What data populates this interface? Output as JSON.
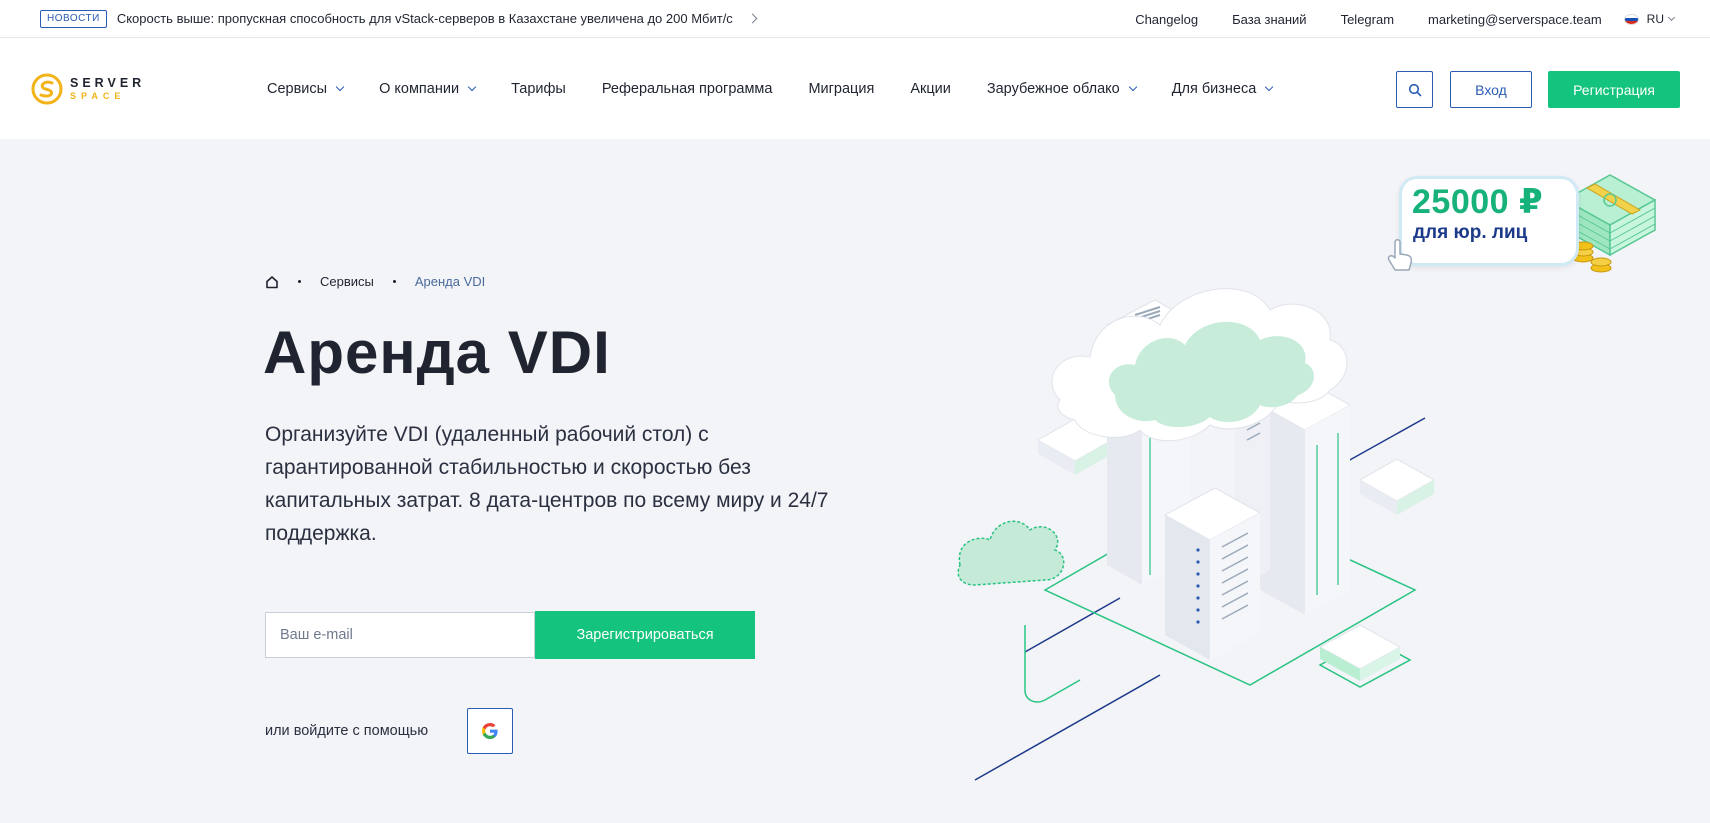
{
  "topbar": {
    "news_badge": "НОВОСТИ",
    "news_text": "Скорость выше: пропускная способность для vStack-серверов в Казахстане увеличена до 200 Мбит/с",
    "links": [
      "Changelog",
      "База знаний",
      "Telegram",
      "marketing@serverspace.team"
    ],
    "lang": "RU"
  },
  "logo": {
    "line1": "SERVER",
    "line2": "SPACE"
  },
  "nav": {
    "items": [
      {
        "label": "Сервисы",
        "dropdown": true
      },
      {
        "label": "О компании",
        "dropdown": true
      },
      {
        "label": "Тарифы",
        "dropdown": false
      },
      {
        "label": "Реферальная программа",
        "dropdown": false
      },
      {
        "label": "Миграция",
        "dropdown": false
      },
      {
        "label": "Акции",
        "dropdown": false
      },
      {
        "label": "Зарубежное облако",
        "dropdown": true
      },
      {
        "label": "Для бизнеса",
        "dropdown": true
      }
    ],
    "login": "Вход",
    "register": "Регистрация"
  },
  "breadcrumb": {
    "services": "Сервисы",
    "current": "Аренда VDI"
  },
  "hero": {
    "title": "Аренда VDI",
    "description": "Организуйте VDI (удаленный рабочий стол) с гарантированной стабильностью и скоростью без капитальных затрат. 8 дата-центров по всему миру и 24/7 поддержка.",
    "email_placeholder": "Ваш e-mail",
    "submit": "Зарегистрироваться",
    "alt_login": "или войдите с помощью"
  },
  "promo": {
    "amount": "25000 ₽",
    "sub": "для юр. лиц"
  },
  "colors": {
    "accent_green": "#14c47e",
    "accent_blue": "#2a5bb5",
    "logo_yellow": "#f2b418",
    "background": "#f3f4f8"
  },
  "icons": {
    "search": "search-icon",
    "home": "home-icon",
    "google": "google-icon",
    "flag": "russia-flag-icon"
  }
}
